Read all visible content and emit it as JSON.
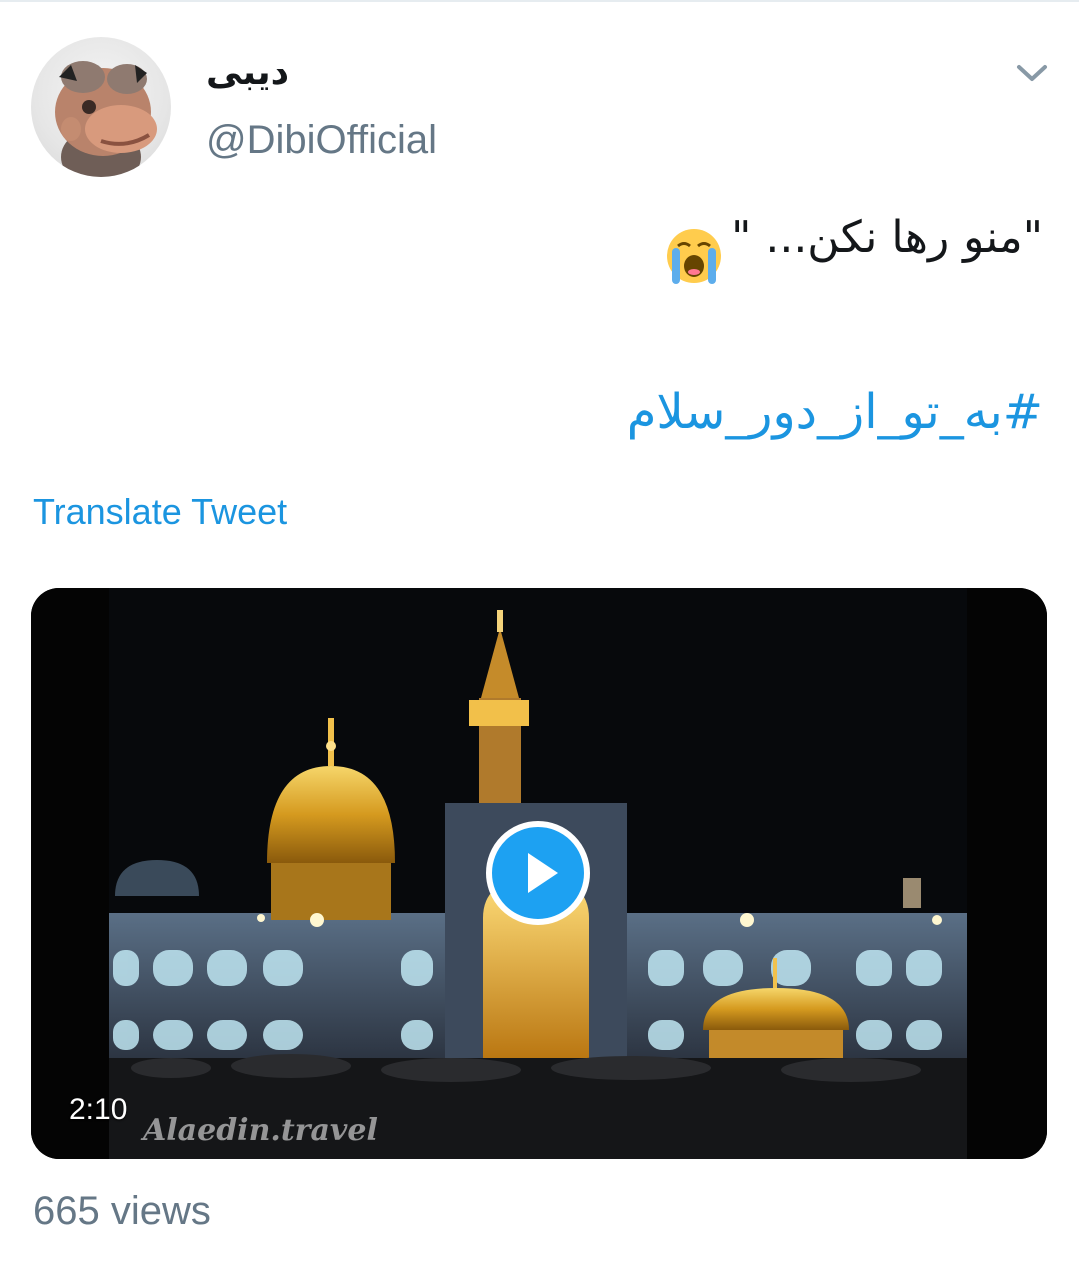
{
  "tweet": {
    "author": {
      "display_name": "دیبی",
      "handle": "@DibiOfficial",
      "avatar_icon": "avatar-character-icon"
    },
    "menu_icon": "chevron-down-icon",
    "text": "\"منو رها نکن... \"",
    "text_emoji": "loudly-crying-face-emoji",
    "hashtag": "#به_تو_از_دور_سلام",
    "translate_label": "Translate Tweet",
    "media": {
      "type": "video",
      "duration": "2:10",
      "watermark": "Alaedin.travel",
      "play_icon": "play-icon"
    },
    "views": "665 views"
  },
  "colors": {
    "link": "#1b95e0",
    "secondary_text": "#657786",
    "primary_text": "#14171a",
    "play_button": "#1da1f2"
  }
}
